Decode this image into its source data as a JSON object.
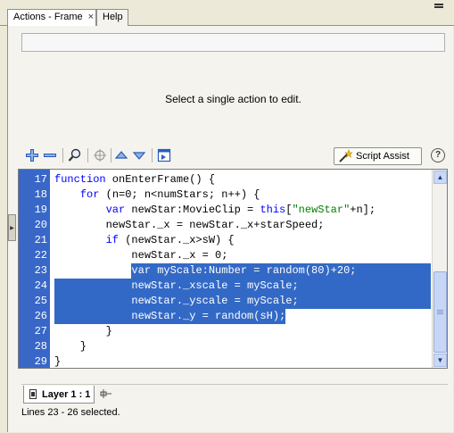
{
  "tabs": [
    {
      "label": "Actions - Frame",
      "close": "×"
    },
    {
      "label": "Help"
    }
  ],
  "message": "Select a single action to edit.",
  "toolbar": {
    "buttons": [
      "add-icon",
      "remove-icon",
      "find-icon",
      "target-icon",
      "move-up-icon",
      "move-down-icon",
      "script-window-icon"
    ],
    "script_assist_label": "Script Assist",
    "help_label": "?"
  },
  "code": {
    "selected_lines": [
      23,
      24,
      25,
      26
    ],
    "lines": [
      {
        "n": "17",
        "text": "function onEnterFrame() {"
      },
      {
        "n": "18",
        "text": "    for (n=0; n<numStars; n++) {"
      },
      {
        "n": "19",
        "text": "        var newStar:MovieClip = this[\"newStar\"+n];"
      },
      {
        "n": "20",
        "text": "        newStar._x = newStar._x+starSpeed;"
      },
      {
        "n": "21",
        "text": "        if (newStar._x>sW) {"
      },
      {
        "n": "22",
        "text": "            newStar._x = 0;"
      },
      {
        "n": "23",
        "text": "            var myScale:Number = random(80)+20;"
      },
      {
        "n": "24",
        "text": "            newStar._xscale = myScale;"
      },
      {
        "n": "25",
        "text": "            newStar._yscale = myScale;"
      },
      {
        "n": "26",
        "text": "            newStar._y = random(sH);"
      },
      {
        "n": "27",
        "text": "        }"
      },
      {
        "n": "28",
        "text": "    }"
      },
      {
        "n": "29",
        "text": "}"
      }
    ]
  },
  "layer": {
    "label": "Layer 1 : 1"
  },
  "status": "Lines 23 - 26 selected."
}
